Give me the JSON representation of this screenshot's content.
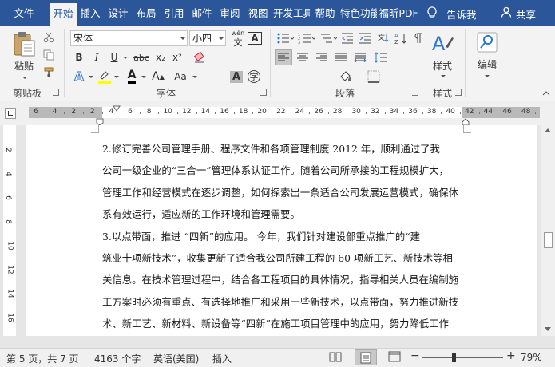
{
  "tabs": [
    "文件",
    "开始",
    "插入",
    "设计",
    "布局",
    "引用",
    "邮件",
    "审阅",
    "视图",
    "开发工具",
    "帮助",
    "特色功能",
    "福昕PDF"
  ],
  "tab_active": 1,
  "tell_me": "告诉我",
  "share": "共享",
  "clipboard": {
    "paste_label": "粘贴",
    "group_label": "剪贴板"
  },
  "font": {
    "name": "宋体",
    "size": "小四",
    "group_label": "字体",
    "bold": "B",
    "italic": "I",
    "underline": "U",
    "strike": "abc",
    "sub": "x₂",
    "sup": "x²",
    "effects": "A",
    "grow": "A",
    "case": "Aa",
    "clear": "A",
    "wen": "wén",
    "border": "A",
    "highlight_color": "#ffff00",
    "font_color": "#000000"
  },
  "paragraph": {
    "group_label": "段落"
  },
  "styles": {
    "label": "样式",
    "group_label": "样式"
  },
  "editing": {
    "label": "编辑"
  },
  "ruler": {
    "numbers": [
      "6",
      "4",
      "2",
      "2",
      "4",
      "6",
      "8",
      "10",
      "12",
      "14",
      "16",
      "18",
      "20",
      "22",
      "24",
      "26",
      "28",
      "30",
      "32",
      "34",
      "36",
      "38",
      "40",
      "42",
      "44",
      "46",
      "48"
    ]
  },
  "vruler": {
    "numbers": [
      "2",
      "4",
      "6",
      "8",
      "10",
      "12",
      "14",
      "16"
    ]
  },
  "document": {
    "lines": [
      "    2.修订完善公司管理手册、程序文件和各项管理制度 2012 年，顺利通过了我",
      "公司一级企业的“三合一”管理体系认证工作。随着公司所承接的工程规模扩大，",
      "管理工作和经营模式在逐步调整，如何探索出一条适合公司发展运营模式，确保体",
      "系有效运行，适应新的工作环境和管理需要。",
      "    3.以点带面，推进 “四新”的应用。 今年，我们针对建设部重点推广的“建",
      "筑业十项新技术”，收集更新了适合我公司所建工程的 60 项新工艺、新技术等相",
      "关信息。在技术管理过程中，结合各工程项目的具体情况，指导相关人员在编制施",
      "工方案时必须有重点、有选择地推广和采用一些新技术，以点带面，努力推进新技",
      "术、新工艺、新材料、新设备等“四新”在施工项目管理中的应用，努力降低工作"
    ]
  },
  "status": {
    "page": "第 5 页，共 7 页",
    "words": "4163 个字",
    "language": "英语(美国)",
    "mode": "插入",
    "zoom": "79%"
  }
}
